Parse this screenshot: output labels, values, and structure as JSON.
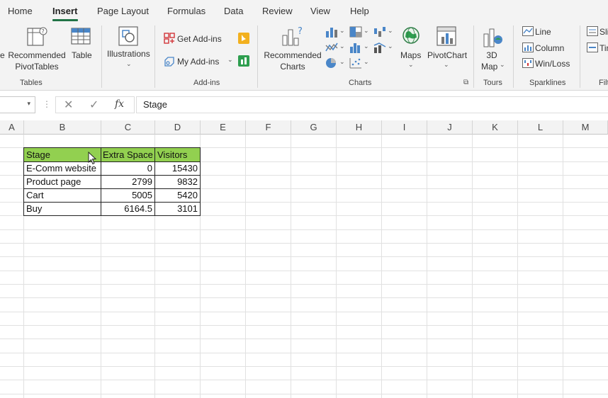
{
  "ribbon_tabs": [
    "Home",
    "Insert",
    "Page Layout",
    "Formulas",
    "Data",
    "Review",
    "View",
    "Help"
  ],
  "active_tab": "Insert",
  "groups": {
    "tables": {
      "label": "Tables",
      "recommended_pivot_line1": "Recommended",
      "recommended_pivot_line2": "PivotTables",
      "table": "Table"
    },
    "illustrations": {
      "label": "Illustrations"
    },
    "addins": {
      "label": "Add-ins",
      "get_addins": "Get Add-ins",
      "my_addins": "My Add-ins"
    },
    "charts": {
      "label": "Charts",
      "recommended_line1": "Recommended",
      "recommended_line2": "Charts",
      "maps": "Maps",
      "pivotchart": "PivotChart"
    },
    "tours": {
      "label": "Tours",
      "map3d_line1": "3D",
      "map3d_line2": "Map"
    },
    "sparklines": {
      "label": "Sparklines",
      "line": "Line",
      "column": "Column",
      "winloss": "Win/Loss"
    },
    "filters_partial": {
      "label": "Filt",
      "slicer": "Sli",
      "timeline": "Tin"
    }
  },
  "ribbon_fragment_left": "e",
  "formula_bar": {
    "fx": "fx",
    "value": "Stage"
  },
  "columns": [
    "A",
    "B",
    "C",
    "D",
    "E",
    "F",
    "G",
    "H",
    "I",
    "J",
    "K",
    "L",
    "M"
  ],
  "table": {
    "headers": [
      "Stage",
      "Extra Space",
      "Visitors"
    ],
    "rows": [
      [
        "E-Comm website",
        "0",
        "15430"
      ],
      [
        "Product page",
        "2799",
        "9832"
      ],
      [
        "Cart",
        "5005",
        "5420"
      ],
      [
        "Buy",
        "6164.5",
        "3101"
      ]
    ]
  },
  "colors": {
    "accent": "#217346",
    "header_fill": "#92d050"
  }
}
